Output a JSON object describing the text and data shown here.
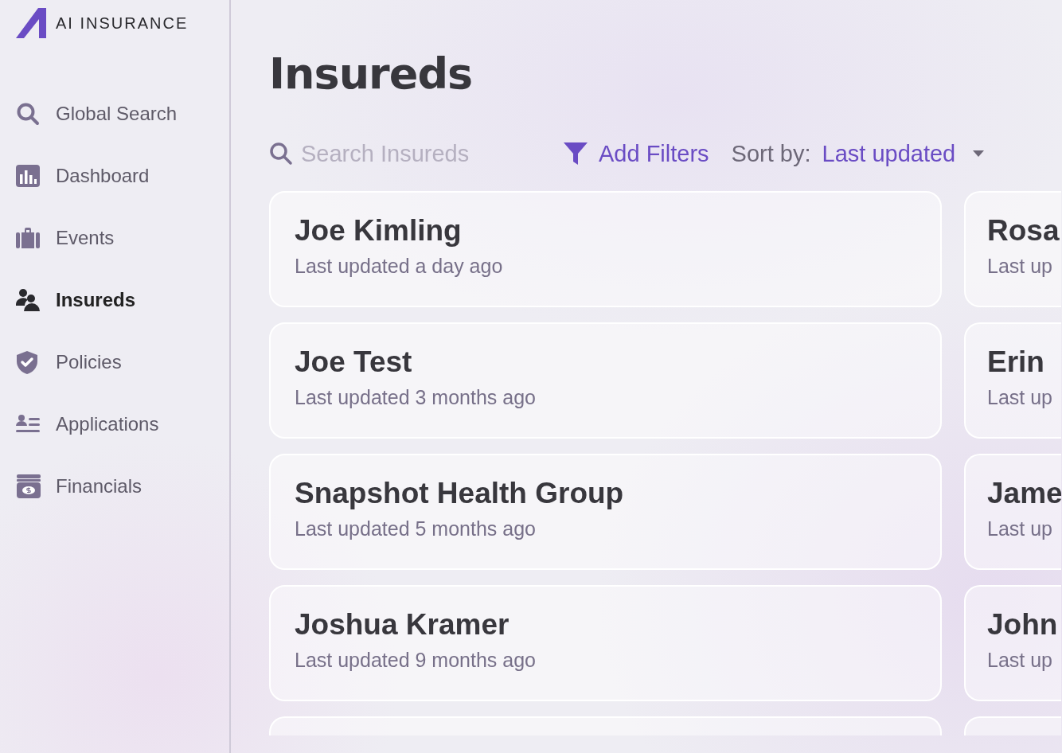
{
  "brand": {
    "name": "AI INSURANCE"
  },
  "sidebar": {
    "items": [
      {
        "label": "Global Search",
        "selected": false
      },
      {
        "label": "Dashboard",
        "selected": false
      },
      {
        "label": "Events",
        "selected": false
      },
      {
        "label": "Insureds",
        "selected": true
      },
      {
        "label": "Policies",
        "selected": false
      },
      {
        "label": "Applications",
        "selected": false
      },
      {
        "label": "Financials",
        "selected": false
      }
    ]
  },
  "page": {
    "title": "Insureds"
  },
  "toolbar": {
    "search": {
      "placeholder": "Search Insureds"
    },
    "filter_button": "Add Filters",
    "sort_label": "Sort by:",
    "sort_value": "Last updated"
  },
  "cards": [
    {
      "name": "Joe Kimling",
      "updated": "Last updated a day ago"
    },
    {
      "name": "Rosa",
      "updated": "Last up"
    },
    {
      "name": "Joe Test",
      "updated": "Last updated 3 months ago"
    },
    {
      "name": "Erin",
      "updated": "Last up"
    },
    {
      "name": "Snapshot Health Group",
      "updated": "Last updated 5 months ago"
    },
    {
      "name": "Jame",
      "updated": "Last up"
    },
    {
      "name": "Joshua Kramer",
      "updated": "Last updated 9 months ago"
    },
    {
      "name": "John",
      "updated": "Last up"
    }
  ]
}
